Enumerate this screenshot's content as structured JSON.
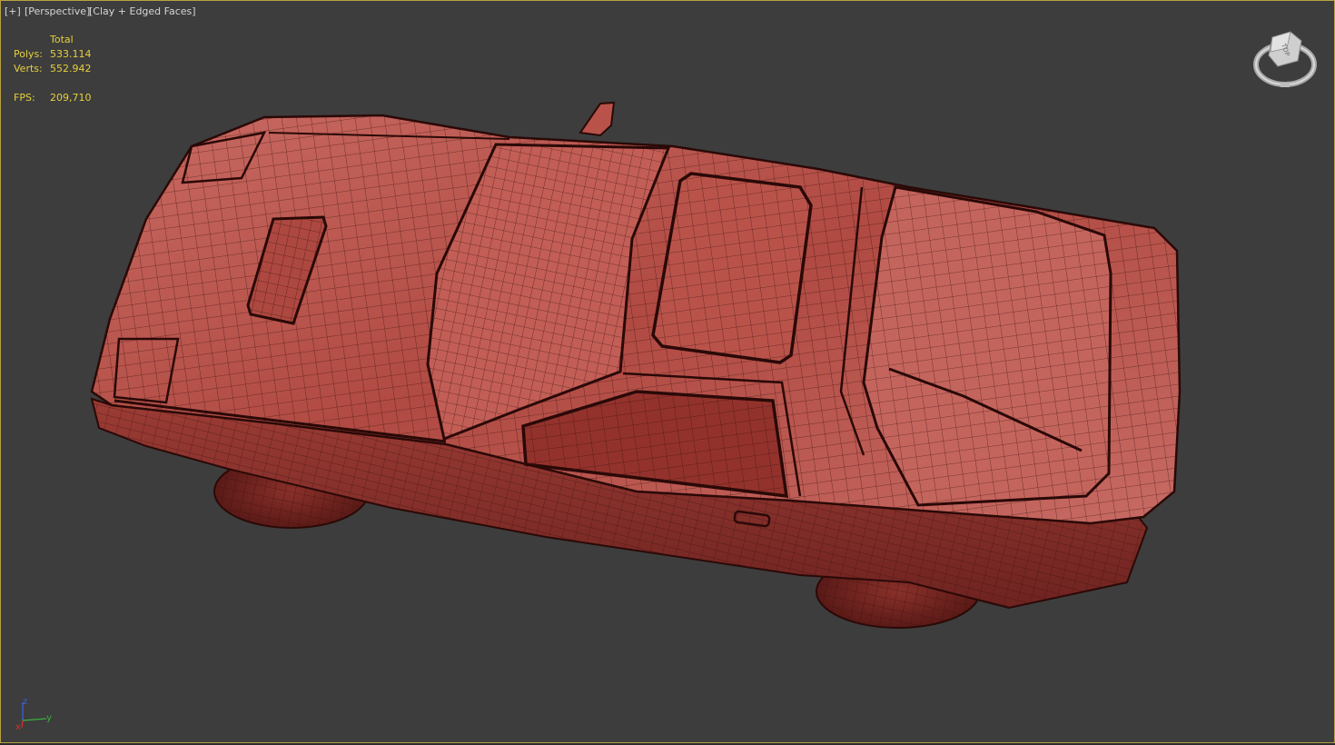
{
  "viewport": {
    "labels": {
      "plus": "[+]",
      "view": "[Perspective]",
      "shading": "[Clay + Edged Faces]"
    },
    "border_color": "#b8a144",
    "background_color": "#3d3d3d"
  },
  "stats": {
    "header": "Total",
    "polys_label": "Polys:",
    "polys_value": "533.114",
    "verts_label": "Verts:",
    "verts_value": "552.942",
    "fps_label": "FPS:",
    "fps_value": "209,710",
    "text_color": "#e6cf3c"
  },
  "model": {
    "clay_color": "#b9534a",
    "edge_color": "#3a0e0c"
  },
  "viewcube": {
    "face_label": "TOP",
    "icon": "viewcube-icon"
  },
  "axis": {
    "x": "x",
    "y": "y",
    "z": "z",
    "colors": {
      "x": "#d03030",
      "y": "#39b239",
      "z": "#3c62d8"
    }
  }
}
